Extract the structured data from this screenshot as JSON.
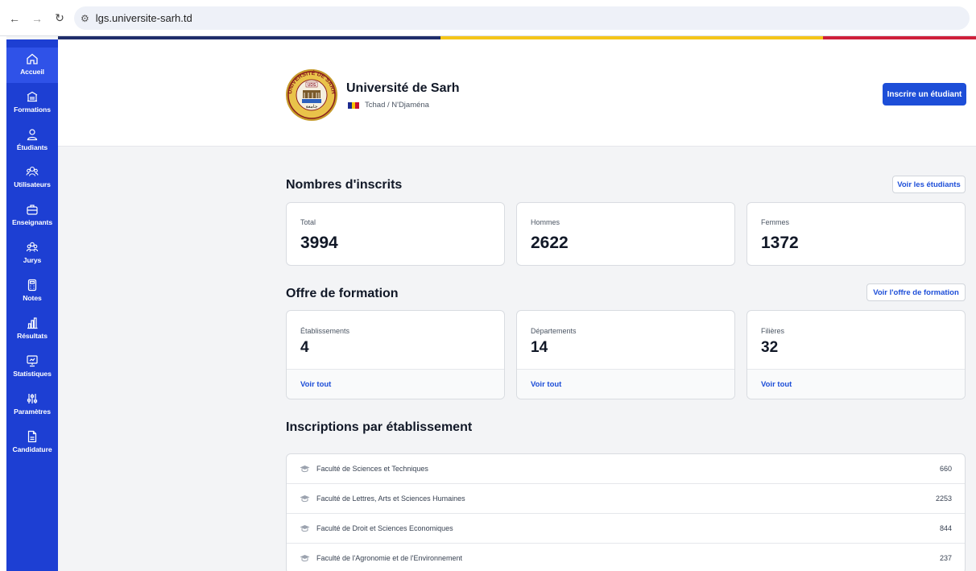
{
  "browser": {
    "back_icon": "arrow-left-icon",
    "forward_icon": "arrow-right-icon",
    "reload_icon": "reload-icon",
    "url": "lgs.universite-sarh.td"
  },
  "colors": {
    "stripe": [
      "#1f2d6b",
      "#f5c518",
      "#cf1f3a"
    ],
    "sidebar": "#1d3fd3",
    "sidebar_active": "#2f52e8",
    "accent": "#1d4ed8",
    "flag": [
      "#1d2b8f",
      "#f6c400",
      "#c8102e"
    ]
  },
  "sidebar": {
    "items": [
      {
        "label": "Accueil",
        "icon": "home-icon"
      },
      {
        "label": "Formations",
        "icon": "building-icon"
      },
      {
        "label": "Étudiants",
        "icon": "user-icon"
      },
      {
        "label": "Utilisateurs",
        "icon": "users-icon"
      },
      {
        "label": "Enseignants",
        "icon": "briefcase-icon"
      },
      {
        "label": "Jurys",
        "icon": "group-icon"
      },
      {
        "label": "Notes",
        "icon": "calculator-icon"
      },
      {
        "label": "Résultats",
        "icon": "bar-chart-icon"
      },
      {
        "label": "Statistiques",
        "icon": "presentation-icon"
      },
      {
        "label": "Paramètres",
        "icon": "sliders-icon"
      },
      {
        "label": "Candidature",
        "icon": "document-icon"
      }
    ]
  },
  "header": {
    "university_name": "Université de Sarh",
    "location": "Tchad / N'Djaména",
    "logo_text": [
      "UNIVERSITÉ DE SARH",
      "UDS"
    ],
    "enroll_button": "Inscrire un étudiant"
  },
  "enrolled": {
    "title": "Nombres d'inscrits",
    "view_button": "Voir les étudiants",
    "cards": [
      {
        "label": "Total",
        "value": "3994"
      },
      {
        "label": "Hommes",
        "value": "2622"
      },
      {
        "label": "Femmes",
        "value": "1372"
      }
    ]
  },
  "offer": {
    "title": "Offre de formation",
    "view_button": "Voir l'offre de formation",
    "cards": [
      {
        "label": "Établissements",
        "value": "4",
        "link": "Voir tout"
      },
      {
        "label": "Départements",
        "value": "14",
        "link": "Voir tout"
      },
      {
        "label": "Filières",
        "value": "32",
        "link": "Voir tout"
      }
    ]
  },
  "by_institution": {
    "title": "Inscriptions par établissement",
    "rows": [
      {
        "name": "Faculté de Sciences et Techniques",
        "count": "660",
        "icon": "graduation-cap-icon"
      },
      {
        "name": "Faculté de Lettres, Arts et Sciences Humaines",
        "count": "2253",
        "icon": "graduation-cap-icon"
      },
      {
        "name": "Faculté de Droit et Sciences Economiques",
        "count": "844",
        "icon": "graduation-cap-icon"
      },
      {
        "name": "Faculté de l'Agronomie et de l'Environnement",
        "count": "237",
        "icon": "graduation-cap-icon"
      }
    ]
  }
}
